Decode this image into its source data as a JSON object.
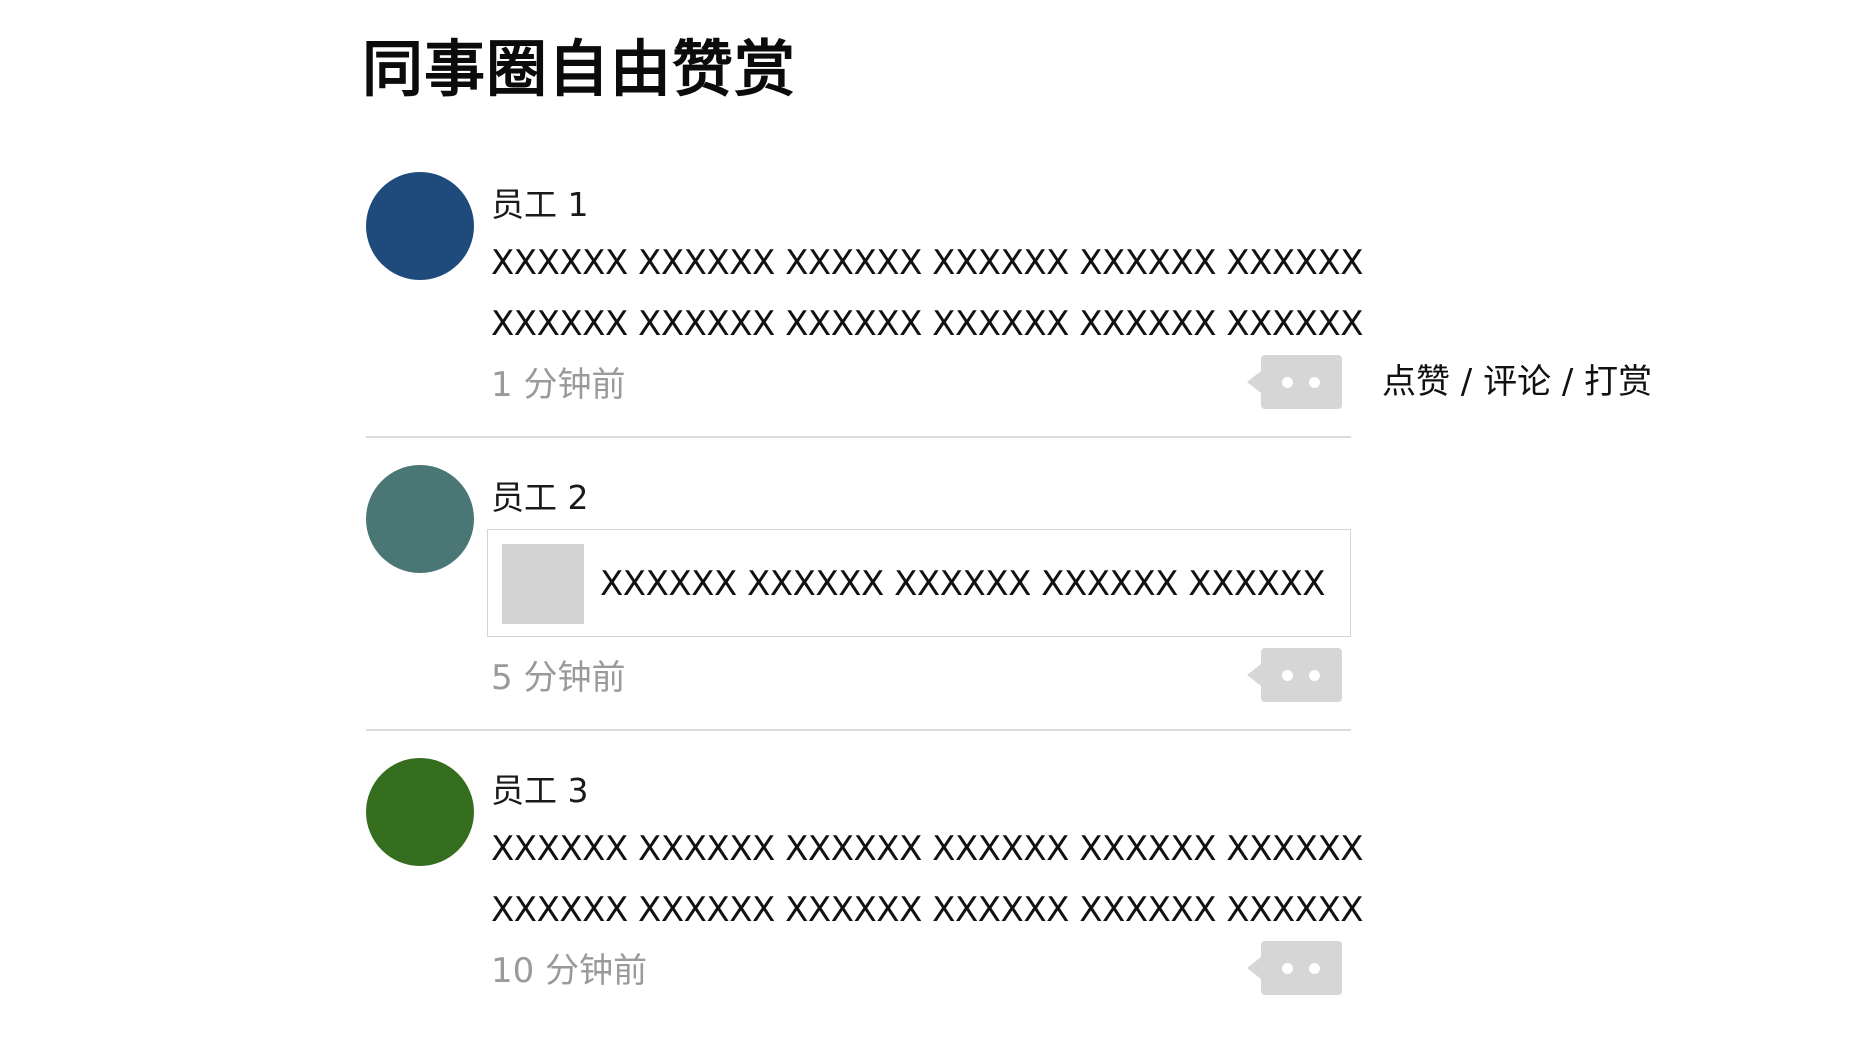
{
  "page": {
    "title": "同事圈自由赞赏"
  },
  "actions": {
    "label": "点赞 / 评论 / 打赏"
  },
  "colors": {
    "avatar_1": "#1f4b7c",
    "avatar_2": "#4a7676",
    "avatar_3": "#346e1e",
    "comment_button": "#d6d6d6",
    "time_text": "#9a9a9a"
  },
  "posts": [
    {
      "author": "员工 1",
      "lines": [
        "XXXXXX XXXXXX XXXXXX XXXXXX XXXXXX XXXXXX",
        "XXXXXX XXXXXX XXXXXX XXXXXX XXXXXX XXXXXX"
      ],
      "time": "1 分钟前",
      "comment_icon": "comment-bubble-icon"
    },
    {
      "author": "员工 2",
      "share_text": "XXXXXX XXXXXX XXXXXX XXXXXX XXXXXX",
      "time": "5 分钟前",
      "comment_icon": "comment-bubble-icon"
    },
    {
      "author": "员工 3",
      "lines": [
        "XXXXXX XXXXXX XXXXXX XXXXXX XXXXXX XXXXXX",
        "XXXXXX XXXXXX XXXXXX XXXXXX XXXXXX XXXXXX"
      ],
      "time": "10 分钟前",
      "comment_icon": "comment-bubble-icon"
    }
  ]
}
